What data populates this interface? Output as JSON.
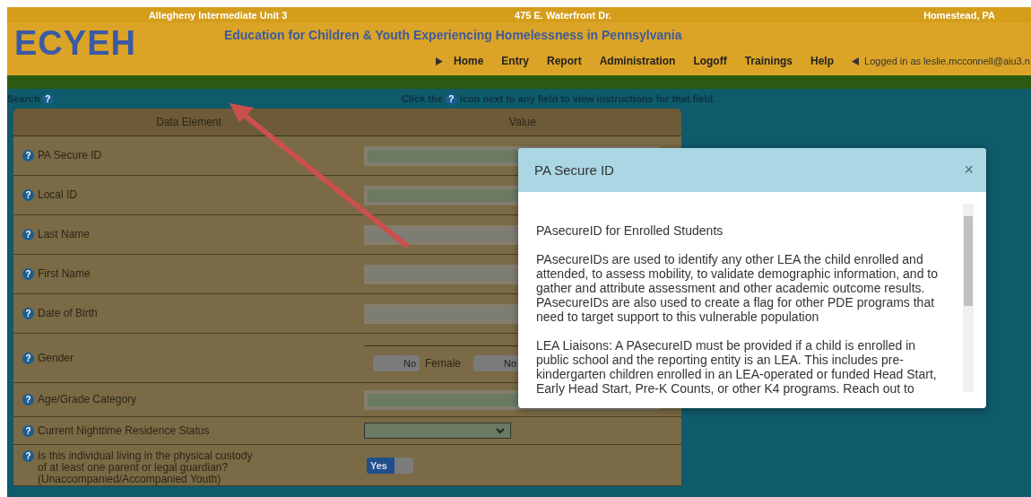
{
  "info_bar": [
    "Allegheny Intermediate Unit 3",
    "475 E. Waterfront Dr.",
    "Homestead, PA"
  ],
  "logo": "ECYEH",
  "site_title": "Education for Children & Youth Experiencing Homelessness in Pennsylvania",
  "nav": [
    "Home",
    "Entry",
    "Report",
    "Administration",
    "Logoff",
    "Trainings",
    "Help"
  ],
  "logged_in": "Logged in as leslie.mcconnell@aiu3.n",
  "search": {
    "label": "Search",
    "help": "?"
  },
  "instruction": {
    "before": "Click the",
    "help": "?",
    "after": "icon next to any field to view instructions for that field."
  },
  "table": {
    "columns": [
      "Data Element",
      "Value"
    ],
    "rows": [
      {
        "help": "?",
        "label": "PA Secure ID",
        "kind": "text",
        "disabled": true
      },
      {
        "help": "?",
        "label": "Local ID",
        "kind": "text",
        "disabled": true
      },
      {
        "help": "?",
        "label": "Last Name",
        "kind": "text",
        "disabled": false
      },
      {
        "help": "?",
        "label": "First Name",
        "kind": "text",
        "disabled": false
      },
      {
        "help": "?",
        "label": "Date of Birth",
        "kind": "text",
        "disabled": false
      },
      {
        "help": "?",
        "label": "Gender",
        "kind": "toggles",
        "toggles": [
          {
            "text": "No",
            "on": false,
            "label": "Female"
          },
          {
            "text": "No",
            "on": false
          }
        ]
      },
      {
        "help": "?",
        "label": "Age/Grade Category",
        "kind": "text",
        "disabled": true
      },
      {
        "help": "?",
        "label": "Current Nighttime Residence Status",
        "kind": "select"
      },
      {
        "help": "?",
        "label": "Is this individual living in the physical custody\nof at least one parent or legal guardian?\n(Unaccompanied/Accompanied Youth)",
        "kind": "toggles",
        "toggles": [
          {
            "text": "Yes",
            "on": true
          }
        ]
      }
    ]
  },
  "modal": {
    "title": "PA Secure ID",
    "close": "×",
    "paragraphs": [
      "PAsecureID for Enrolled Students",
      "PAsecureIDs are used to identify any other LEA the child enrolled and attended, to assess mobility, to validate demographic information, and to gather and attribute assessment and other academic outcome results. PAsecureIDs are also used to create a flag for other PDE programs that need to target support to this vulnerable population",
      "LEA Liaisons: A PAsecureID must be provided if a child is enrolled in public school and the reporting entity is an LEA. This includes pre-kindergarten children enrolled in an LEA-operated or funded Head Start, Early Head Start, Pre-K Counts, or other K4 programs. Reach out to"
    ]
  }
}
